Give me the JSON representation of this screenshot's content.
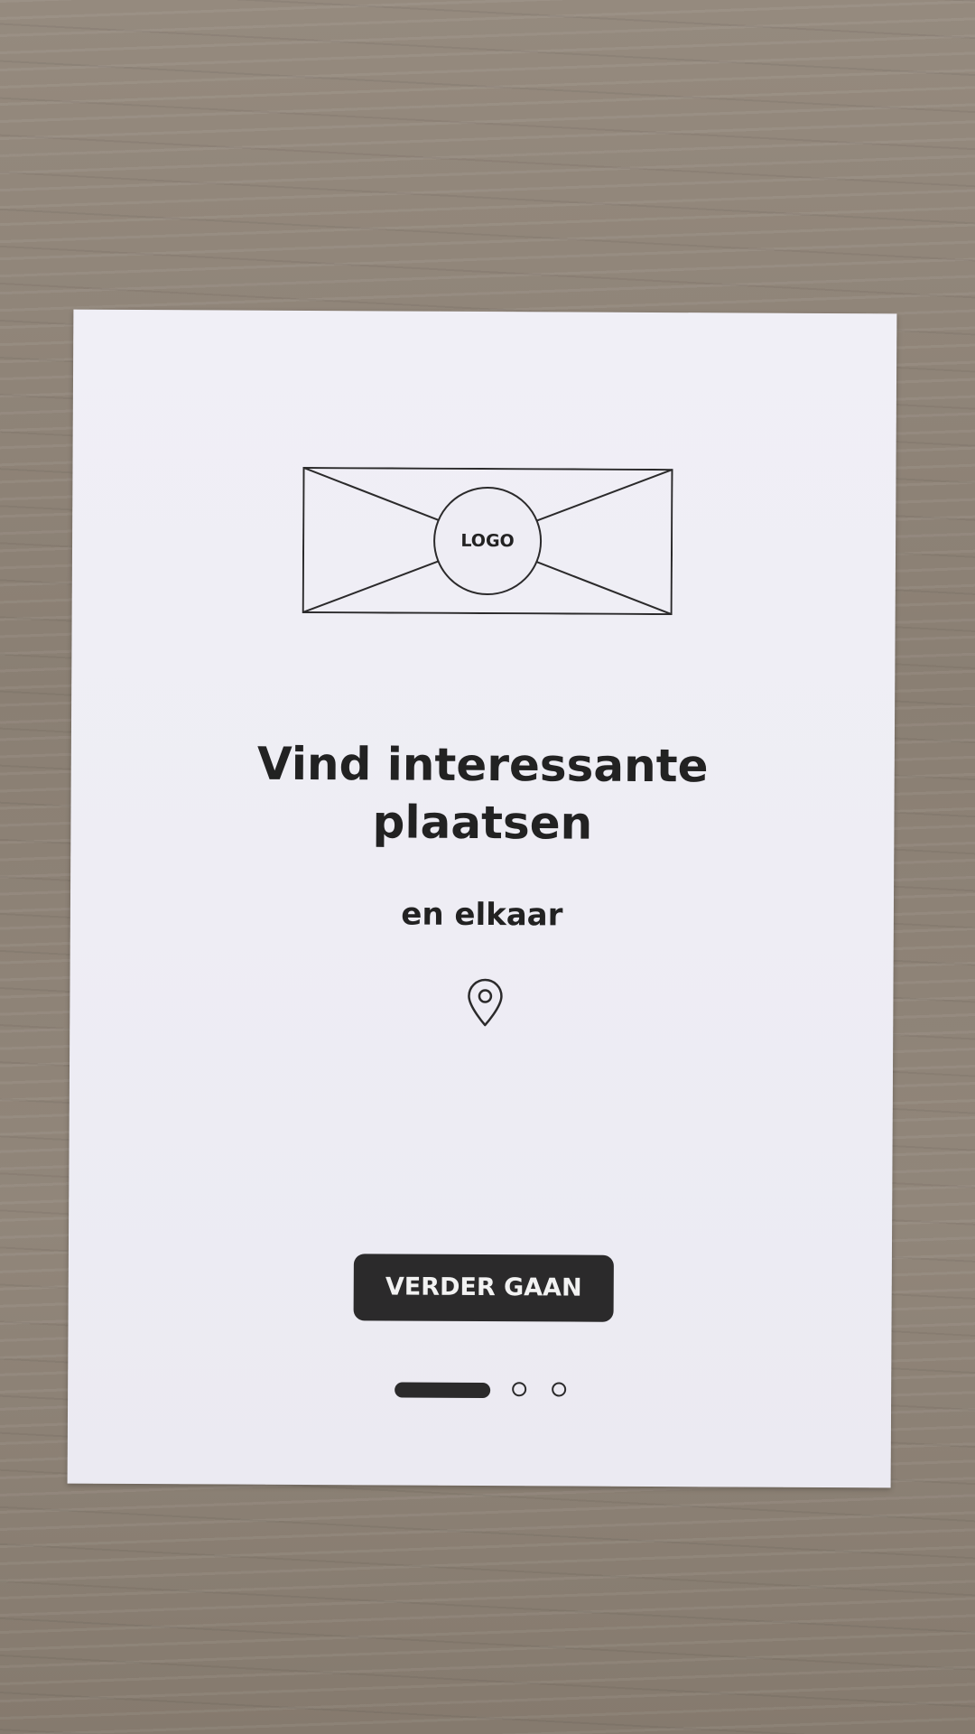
{
  "logo": {
    "label": "LOGO",
    "icon": "image-placeholder-icon"
  },
  "onboarding": {
    "headline_line1": "Vind interessante",
    "headline_line2": "plaatsen",
    "subline": "en elkaar",
    "icon": "location-pin-icon"
  },
  "actions": {
    "continue_label": "VERDER GAAN"
  },
  "pager": {
    "current_page": 1,
    "total_pages": 3
  },
  "colors": {
    "ink": "#2b2a2b",
    "paper": "#eeedf4",
    "button_text": "#f2f2f2"
  }
}
